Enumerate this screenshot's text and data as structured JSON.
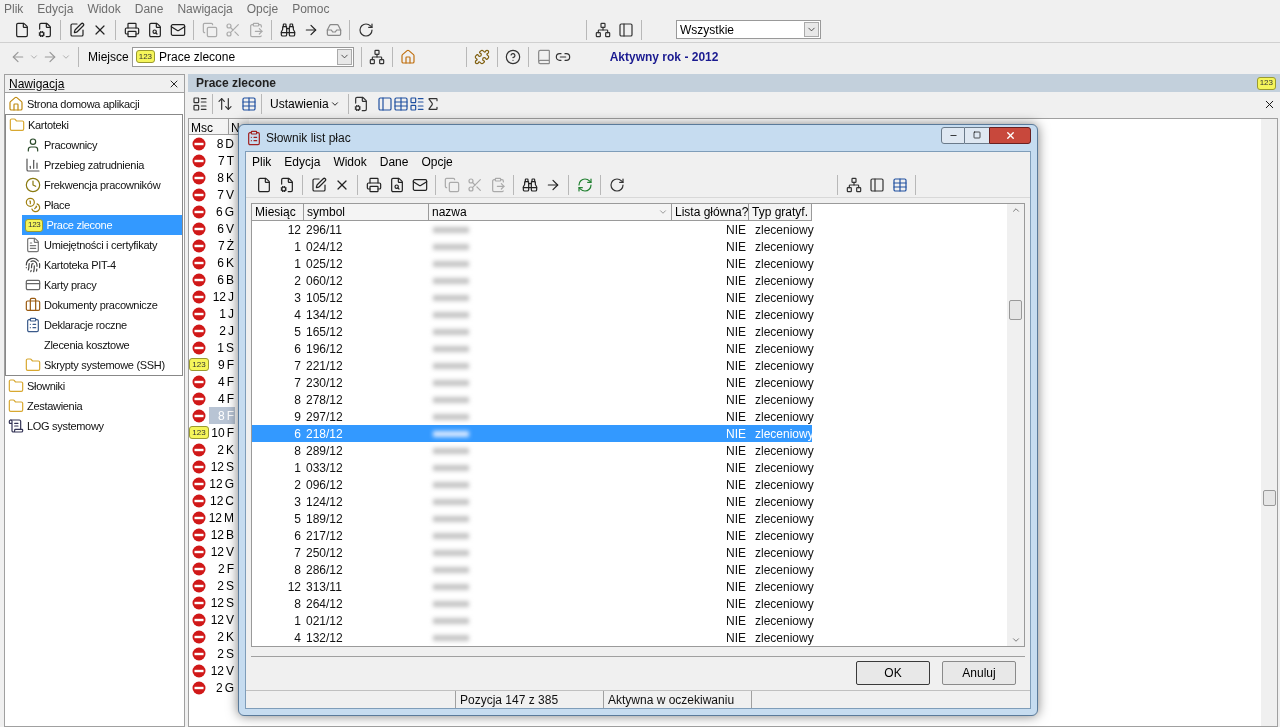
{
  "menu": [
    "Plik",
    "Edycja",
    "Widok",
    "Dane",
    "Nawigacja",
    "Opcje",
    "Pomoc"
  ],
  "filter_combo": {
    "value": "Wszystkie"
  },
  "place": {
    "label": "Miejsce",
    "badge": "123",
    "value": "Prace zlecone"
  },
  "active_year": "Aktywny rok - 2012",
  "navigation": {
    "title": "Nawigacja",
    "items": [
      {
        "label": "Strona domowa aplikacji",
        "kind": "home",
        "selected": false
      },
      {
        "label": "Kartoteki",
        "kind": "folder",
        "selected": false,
        "children": [
          {
            "label": "Pracownicy",
            "kind": "person",
            "selected": false
          },
          {
            "label": "Przebieg zatrudnienia",
            "kind": "chart",
            "selected": false
          },
          {
            "label": "Frekwencja pracowników",
            "kind": "clock",
            "selected": false
          },
          {
            "label": "Płace",
            "kind": "coins",
            "selected": false
          },
          {
            "label": "Prace zlecone",
            "kind": "badge",
            "badge": "123",
            "selected": true
          },
          {
            "label": "Umiejętności i certyfikaty",
            "kind": "document",
            "selected": false
          },
          {
            "label": "Kartoteka PIT-4",
            "kind": "fingerprint",
            "selected": false
          },
          {
            "label": "Karty pracy",
            "kind": "card",
            "selected": false
          },
          {
            "label": "Dokumenty pracownicze",
            "kind": "briefcase",
            "selected": false
          },
          {
            "label": "Deklaracje roczne",
            "kind": "form",
            "selected": false
          },
          {
            "label": "Zlecenia kosztowe",
            "kind": "none",
            "selected": false
          },
          {
            "label": "Skrypty systemowe (SSH)",
            "kind": "folder",
            "selected": false
          }
        ]
      },
      {
        "label": "Słowniki",
        "kind": "folder",
        "selected": false
      },
      {
        "label": "Zestawienia",
        "kind": "folder",
        "selected": false
      },
      {
        "label": "LOG systemowy",
        "kind": "log",
        "selected": false
      }
    ]
  },
  "main": {
    "title": "Prace zlecone",
    "title_badge": "123",
    "settings_button": "Ustawienia",
    "table": {
      "columns": [
        "Msc",
        "N"
      ],
      "rows": [
        {
          "kind": "stop",
          "msc": "8",
          "column_2": "D",
          "selected": false
        },
        {
          "kind": "stop",
          "msc": "7",
          "column_2": "T",
          "selected": false
        },
        {
          "kind": "stop",
          "msc": "8",
          "column_2": "K",
          "selected": false
        },
        {
          "kind": "stop",
          "msc": "7",
          "column_2": "V",
          "selected": false
        },
        {
          "kind": "stop",
          "msc": "6",
          "column_2": "G",
          "selected": false
        },
        {
          "kind": "stop",
          "msc": "6",
          "column_2": "V",
          "selected": false
        },
        {
          "kind": "stop",
          "msc": "7",
          "column_2": "Ż",
          "selected": false
        },
        {
          "kind": "stop",
          "msc": "6",
          "column_2": "K",
          "selected": false
        },
        {
          "kind": "stop",
          "msc": "6",
          "column_2": "B",
          "selected": false
        },
        {
          "kind": "stop",
          "msc": "12",
          "column_2": "J",
          "selected": false
        },
        {
          "kind": "stop",
          "msc": "1",
          "column_2": "J",
          "selected": false
        },
        {
          "kind": "stop",
          "msc": "2",
          "column_2": "J",
          "selected": false
        },
        {
          "kind": "stop",
          "msc": "1",
          "column_2": "S",
          "selected": false
        },
        {
          "kind": "badge",
          "badge": "123",
          "msc": "9",
          "column_2": "F",
          "selected": false
        },
        {
          "kind": "stop",
          "msc": "4",
          "column_2": "F",
          "selected": false
        },
        {
          "kind": "stop",
          "msc": "4",
          "column_2": "F",
          "selected": false
        },
        {
          "kind": "stop",
          "msc": "8",
          "column_2": "F",
          "selected": true
        },
        {
          "kind": "badge",
          "badge": "123",
          "msc": "10",
          "column_2": "F",
          "selected": false
        },
        {
          "kind": "stop",
          "msc": "2",
          "column_2": "K",
          "selected": false
        },
        {
          "kind": "stop",
          "msc": "12",
          "column_2": "S",
          "selected": false
        },
        {
          "kind": "stop",
          "msc": "12",
          "column_2": "G",
          "selected": false
        },
        {
          "kind": "stop",
          "msc": "12",
          "column_2": "C",
          "selected": false
        },
        {
          "kind": "stop",
          "msc": "12",
          "column_2": "M",
          "selected": false
        },
        {
          "kind": "stop",
          "msc": "12",
          "column_2": "B",
          "selected": false
        },
        {
          "kind": "stop",
          "msc": "12",
          "column_2": "V",
          "selected": false
        },
        {
          "kind": "stop",
          "msc": "2",
          "column_2": "F",
          "selected": false
        },
        {
          "kind": "stop",
          "msc": "2",
          "column_2": "S",
          "selected": false
        },
        {
          "kind": "stop",
          "msc": "12",
          "column_2": "S",
          "selected": false
        },
        {
          "kind": "stop",
          "msc": "12",
          "column_2": "V",
          "selected": false
        },
        {
          "kind": "stop",
          "msc": "2",
          "column_2": "K",
          "selected": false
        },
        {
          "kind": "stop",
          "msc": "2",
          "column_2": "S",
          "selected": false
        },
        {
          "kind": "stop",
          "msc": "12",
          "column_2": "V",
          "selected": false
        },
        {
          "kind": "stop",
          "msc": "2",
          "column_2": "G",
          "selected": false
        }
      ]
    }
  },
  "dialog": {
    "title": "Słownik list płac",
    "menu": [
      "Plik",
      "Edycja",
      "Widok",
      "Dane",
      "Opcje"
    ],
    "columns": [
      "Miesiąc",
      "symbol",
      "nazwa",
      "Lista główna?",
      "Typ gratyf."
    ],
    "rows": [
      {
        "month": "12",
        "symbol": "296/11",
        "main_list": "NIE",
        "type": "zleceniowy",
        "selected": false
      },
      {
        "month": "1",
        "symbol": "024/12",
        "main_list": "NIE",
        "type": "zleceniowy",
        "selected": false
      },
      {
        "month": "1",
        "symbol": "025/12",
        "main_list": "NIE",
        "type": "zleceniowy",
        "selected": false
      },
      {
        "month": "2",
        "symbol": "060/12",
        "main_list": "NIE",
        "type": "zleceniowy",
        "selected": false
      },
      {
        "month": "3",
        "symbol": "105/12",
        "main_list": "NIE",
        "type": "zleceniowy",
        "selected": false
      },
      {
        "month": "4",
        "symbol": "134/12",
        "main_list": "NIE",
        "type": "zleceniowy",
        "selected": false
      },
      {
        "month": "5",
        "symbol": "165/12",
        "main_list": "NIE",
        "type": "zleceniowy",
        "selected": false
      },
      {
        "month": "6",
        "symbol": "196/12",
        "main_list": "NIE",
        "type": "zleceniowy",
        "selected": false
      },
      {
        "month": "7",
        "symbol": "221/12",
        "main_list": "NIE",
        "type": "zleceniowy",
        "selected": false
      },
      {
        "month": "7",
        "symbol": "230/12",
        "main_list": "NIE",
        "type": "zleceniowy",
        "selected": false
      },
      {
        "month": "8",
        "symbol": "278/12",
        "main_list": "NIE",
        "type": "zleceniowy",
        "selected": false
      },
      {
        "month": "9",
        "symbol": "297/12",
        "main_list": "NIE",
        "type": "zleceniowy",
        "selected": false
      },
      {
        "month": "6",
        "symbol": "218/12",
        "main_list": "NIE",
        "type": "zleceniowy",
        "selected": true
      },
      {
        "month": "8",
        "symbol": "289/12",
        "main_list": "NIE",
        "type": "zleceniowy",
        "selected": false
      },
      {
        "month": "1",
        "symbol": "033/12",
        "main_list": "NIE",
        "type": "zleceniowy",
        "selected": false
      },
      {
        "month": "2",
        "symbol": "096/12",
        "main_list": "NIE",
        "type": "zleceniowy",
        "selected": false
      },
      {
        "month": "3",
        "symbol": "124/12",
        "main_list": "NIE",
        "type": "zleceniowy",
        "selected": false
      },
      {
        "month": "5",
        "symbol": "189/12",
        "main_list": "NIE",
        "type": "zleceniowy",
        "selected": false
      },
      {
        "month": "6",
        "symbol": "217/12",
        "main_list": "NIE",
        "type": "zleceniowy",
        "selected": false
      },
      {
        "month": "7",
        "symbol": "250/12",
        "main_list": "NIE",
        "type": "zleceniowy",
        "selected": false
      },
      {
        "month": "8",
        "symbol": "286/12",
        "main_list": "NIE",
        "type": "zleceniowy",
        "selected": false
      },
      {
        "month": "12",
        "symbol": "313/11",
        "main_list": "NIE",
        "type": "zleceniowy",
        "selected": false
      },
      {
        "month": "8",
        "symbol": "264/12",
        "main_list": "NIE",
        "type": "zleceniowy",
        "selected": false
      },
      {
        "month": "1",
        "symbol": "021/12",
        "main_list": "NIE",
        "type": "zleceniowy",
        "selected": false
      },
      {
        "month": "4",
        "symbol": "132/12",
        "main_list": "NIE",
        "type": "zleceniowy",
        "selected": false
      }
    ],
    "buttons": [
      "OK",
      "Anuluj"
    ],
    "status": [
      "Pozycja 147 z 385",
      "Aktywna w oczekiwaniu"
    ]
  }
}
